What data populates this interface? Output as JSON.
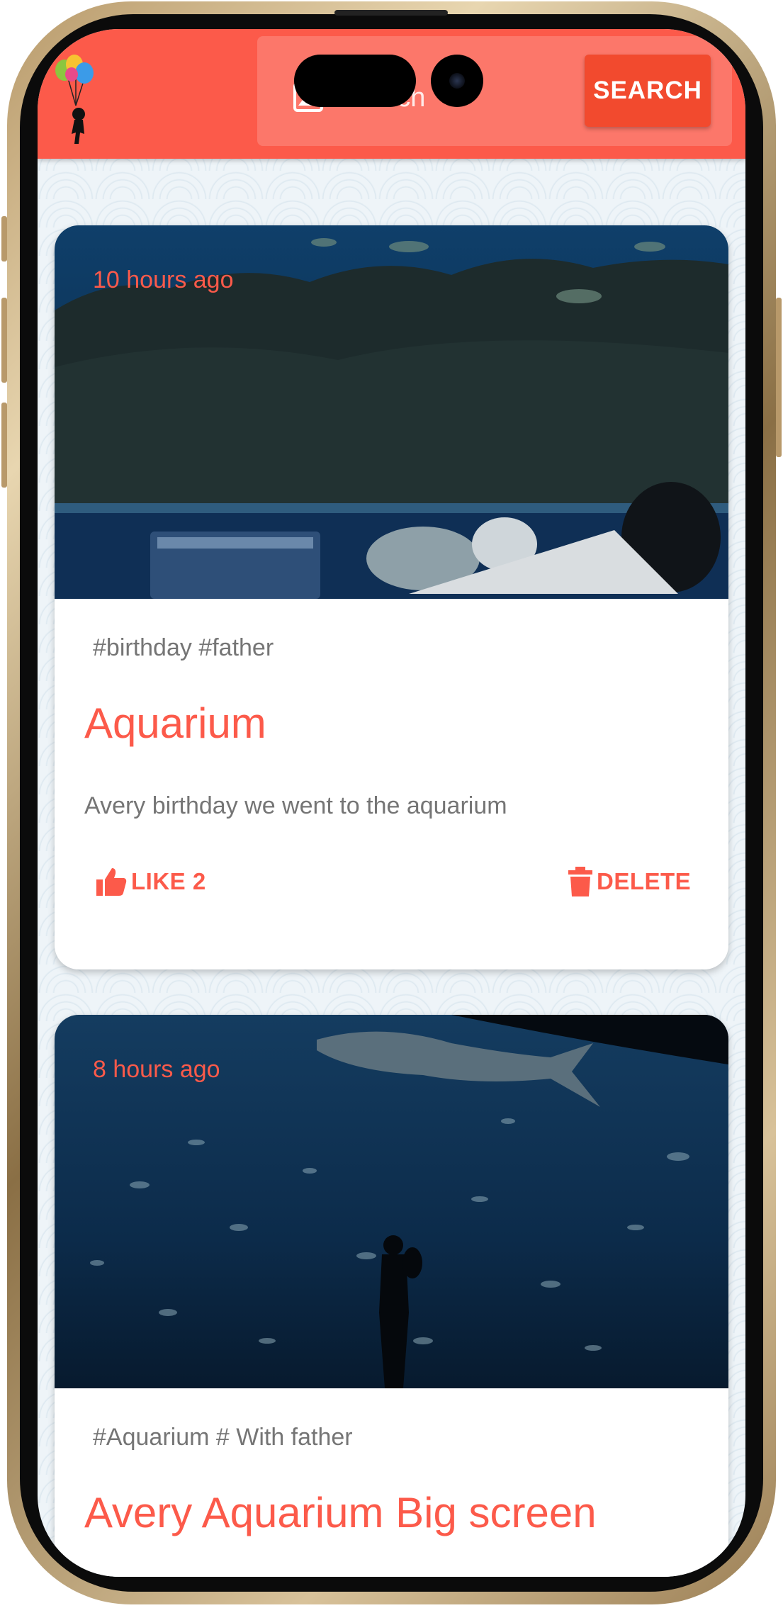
{
  "app_bar": {
    "search_placeholder": "Search",
    "search_button_label": "SEARCH",
    "accent_color": "#fc5a4a",
    "button_color": "#f24a2e"
  },
  "posts": [
    {
      "time_ago": "10 hours ago",
      "tags": "#birthday #father",
      "title": "Aquarium",
      "description": "Avery birthday we went to the aquarium",
      "like_label": "LIKE 2",
      "delete_label": "DELETE"
    },
    {
      "time_ago": "8 hours ago",
      "tags": "#Aquarium # With father",
      "title": "Avery Aquarium Big screen"
    }
  ]
}
